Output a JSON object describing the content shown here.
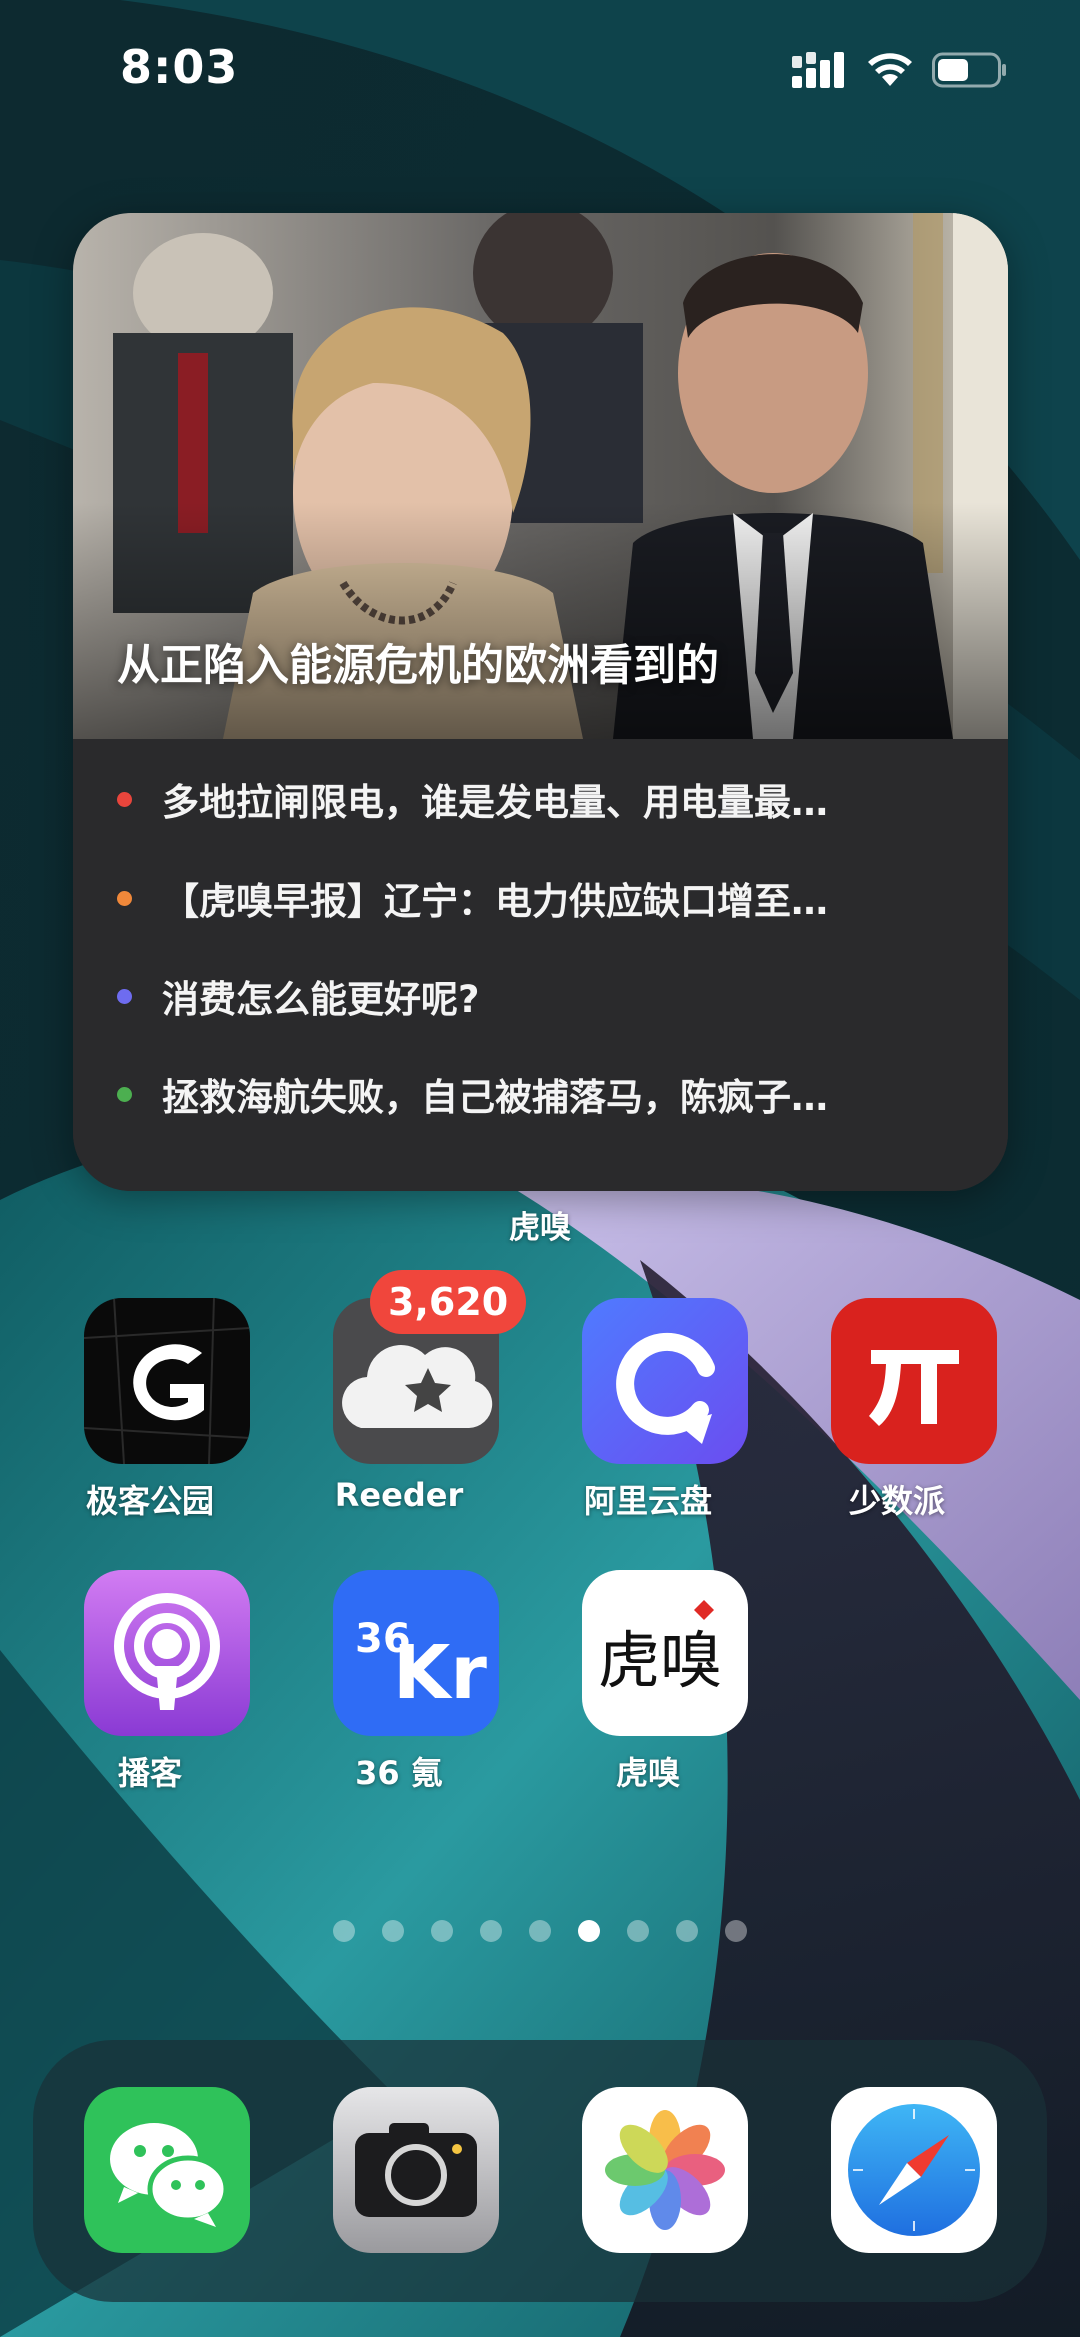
{
  "status_bar": {
    "time": "8:03",
    "icons": [
      "cellular-signal-icon",
      "wifi-icon",
      "battery-icon"
    ]
  },
  "widget": {
    "hero_title": "从正陷入能源危机的欧洲看到的",
    "items": [
      {
        "dot_color": "#e8453c",
        "text": "多地拉闸限电，谁是发电量、用电量最…"
      },
      {
        "dot_color": "#f0883a",
        "text": "【虎嗅早报】辽宁：电力供应缺口增至…"
      },
      {
        "dot_color": "#6e6cf0",
        "text": "消费怎么能更好呢?"
      },
      {
        "dot_color": "#4caf50",
        "text": "拯救海航失败，自己被捕落马，陈疯子…"
      }
    ],
    "label": "虎嗅"
  },
  "apps": {
    "row1": [
      {
        "name": "极客公园",
        "icon": "geekpark-icon"
      },
      {
        "name": "Reeder",
        "icon": "reeder-icon",
        "badge": "3,620"
      },
      {
        "name": "阿里云盘",
        "icon": "aliyun-drive-icon"
      },
      {
        "name": "少数派",
        "icon": "sspai-icon"
      }
    ],
    "row2": [
      {
        "name": "播客",
        "icon": "podcasts-icon"
      },
      {
        "name": "36 氪",
        "icon": "36kr-icon"
      },
      {
        "name": "虎嗅",
        "icon": "huxiu-icon"
      }
    ]
  },
  "page_indicator": {
    "count": 9,
    "active_index": 5
  },
  "dock": [
    "wechat-icon",
    "camera-icon",
    "photos-icon",
    "safari-icon"
  ],
  "colors": {
    "badge": "#f0463c",
    "reeder_bg": "#4a4a4c"
  }
}
